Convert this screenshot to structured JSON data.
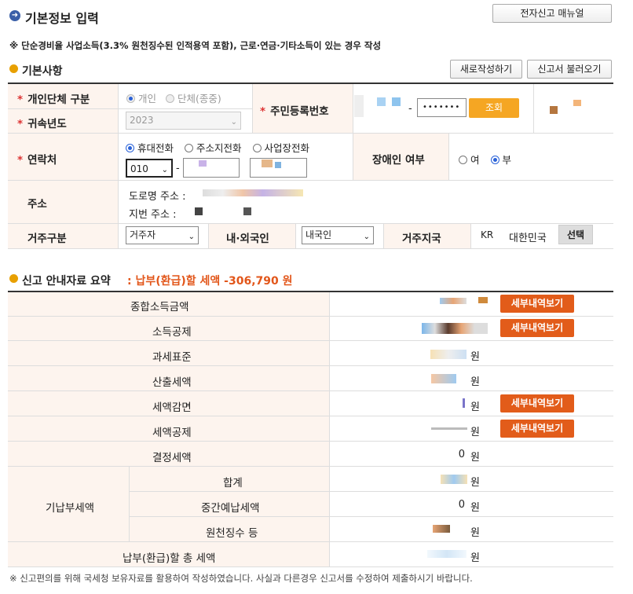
{
  "header": {
    "title": "기본정보 입력",
    "manual_button": "전자신고 매뉴얼",
    "notice": "※ 단순경비율 사업소득(3.3% 원천징수된 인적용역 포함), 근로·연금·기타소득이 있는 경우 작성"
  },
  "basic": {
    "section_title": "기본사항",
    "new_button": "새로작성하기",
    "load_button": "신고서 불러오기",
    "type_label": "개인단체 구분",
    "type_options": [
      "개인",
      "단체(종중)"
    ],
    "year_label": "귀속년도",
    "year_value": "2023",
    "rrn_label": "주민등록번호",
    "rrn_dash": "-",
    "rrn_back": "•••••••",
    "lookup_button": "조회",
    "contact_label": "연락처",
    "contact_options": [
      "휴대전화",
      "주소지전화",
      "사업장전화"
    ],
    "phone_prefix": "010",
    "phone_dash": "-",
    "disability_label": "장애인 여부",
    "disability_options": [
      "여",
      "부"
    ],
    "address_label": "주소",
    "road_label": "도로명 주소 :",
    "lot_label": "지번 주소 :",
    "residence_label": "거주구분",
    "residence_value": "거주자",
    "nationality_label": "내·외국인",
    "nationality_value": "내국인",
    "region_label": "거주지국",
    "region_code": "KR",
    "region_name": "대한민국",
    "select_button": "선택"
  },
  "summary": {
    "section_title": "신고 안내자료 요약",
    "headline": ": 납부(환급)할 세액 -306,790 원",
    "detail_button": "세부내역보기",
    "won": "원",
    "rows": [
      "종합소득금액",
      "소득공제",
      "과세표준",
      "산출세액",
      "세액감면",
      "세액공제",
      "결정세액"
    ],
    "prepaid_group": "기납부세액",
    "prepaid_rows": [
      "합계",
      "중간예납세액",
      "원천징수 등"
    ],
    "total_label": "납부(환급)할 총 세액",
    "decided_value": "0",
    "interim_value": "0"
  },
  "footer": {
    "note": "※ 신고편의를 위해 국세청 보유자료를 활용하여 작성하였습니다. 사실과 다른경우 신고서를 수정하여 제출하시기 바랍니다."
  }
}
